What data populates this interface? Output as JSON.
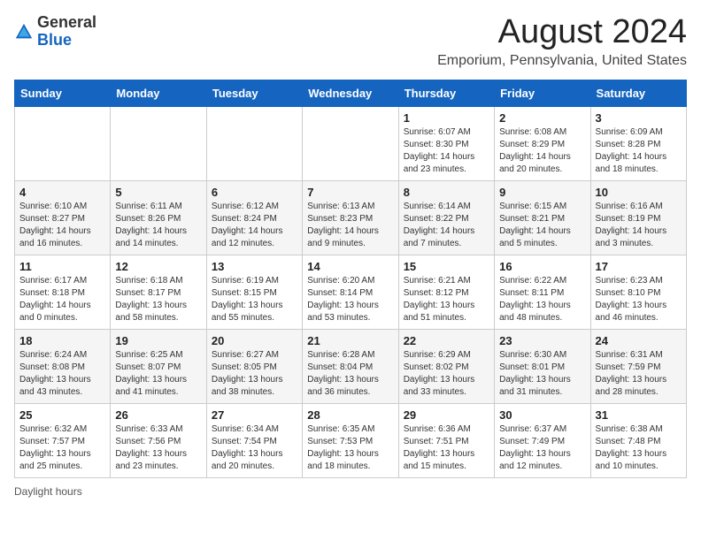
{
  "header": {
    "logo_general": "General",
    "logo_blue": "Blue",
    "title": "August 2024",
    "subtitle": "Emporium, Pennsylvania, United States"
  },
  "calendar": {
    "days_of_week": [
      "Sunday",
      "Monday",
      "Tuesday",
      "Wednesday",
      "Thursday",
      "Friday",
      "Saturday"
    ],
    "weeks": [
      [
        {
          "num": "",
          "info": ""
        },
        {
          "num": "",
          "info": ""
        },
        {
          "num": "",
          "info": ""
        },
        {
          "num": "",
          "info": ""
        },
        {
          "num": "1",
          "info": "Sunrise: 6:07 AM\nSunset: 8:30 PM\nDaylight: 14 hours and 23 minutes."
        },
        {
          "num": "2",
          "info": "Sunrise: 6:08 AM\nSunset: 8:29 PM\nDaylight: 14 hours and 20 minutes."
        },
        {
          "num": "3",
          "info": "Sunrise: 6:09 AM\nSunset: 8:28 PM\nDaylight: 14 hours and 18 minutes."
        }
      ],
      [
        {
          "num": "4",
          "info": "Sunrise: 6:10 AM\nSunset: 8:27 PM\nDaylight: 14 hours and 16 minutes."
        },
        {
          "num": "5",
          "info": "Sunrise: 6:11 AM\nSunset: 8:26 PM\nDaylight: 14 hours and 14 minutes."
        },
        {
          "num": "6",
          "info": "Sunrise: 6:12 AM\nSunset: 8:24 PM\nDaylight: 14 hours and 12 minutes."
        },
        {
          "num": "7",
          "info": "Sunrise: 6:13 AM\nSunset: 8:23 PM\nDaylight: 14 hours and 9 minutes."
        },
        {
          "num": "8",
          "info": "Sunrise: 6:14 AM\nSunset: 8:22 PM\nDaylight: 14 hours and 7 minutes."
        },
        {
          "num": "9",
          "info": "Sunrise: 6:15 AM\nSunset: 8:21 PM\nDaylight: 14 hours and 5 minutes."
        },
        {
          "num": "10",
          "info": "Sunrise: 6:16 AM\nSunset: 8:19 PM\nDaylight: 14 hours and 3 minutes."
        }
      ],
      [
        {
          "num": "11",
          "info": "Sunrise: 6:17 AM\nSunset: 8:18 PM\nDaylight: 14 hours and 0 minutes."
        },
        {
          "num": "12",
          "info": "Sunrise: 6:18 AM\nSunset: 8:17 PM\nDaylight: 13 hours and 58 minutes."
        },
        {
          "num": "13",
          "info": "Sunrise: 6:19 AM\nSunset: 8:15 PM\nDaylight: 13 hours and 55 minutes."
        },
        {
          "num": "14",
          "info": "Sunrise: 6:20 AM\nSunset: 8:14 PM\nDaylight: 13 hours and 53 minutes."
        },
        {
          "num": "15",
          "info": "Sunrise: 6:21 AM\nSunset: 8:12 PM\nDaylight: 13 hours and 51 minutes."
        },
        {
          "num": "16",
          "info": "Sunrise: 6:22 AM\nSunset: 8:11 PM\nDaylight: 13 hours and 48 minutes."
        },
        {
          "num": "17",
          "info": "Sunrise: 6:23 AM\nSunset: 8:10 PM\nDaylight: 13 hours and 46 minutes."
        }
      ],
      [
        {
          "num": "18",
          "info": "Sunrise: 6:24 AM\nSunset: 8:08 PM\nDaylight: 13 hours and 43 minutes."
        },
        {
          "num": "19",
          "info": "Sunrise: 6:25 AM\nSunset: 8:07 PM\nDaylight: 13 hours and 41 minutes."
        },
        {
          "num": "20",
          "info": "Sunrise: 6:27 AM\nSunset: 8:05 PM\nDaylight: 13 hours and 38 minutes."
        },
        {
          "num": "21",
          "info": "Sunrise: 6:28 AM\nSunset: 8:04 PM\nDaylight: 13 hours and 36 minutes."
        },
        {
          "num": "22",
          "info": "Sunrise: 6:29 AM\nSunset: 8:02 PM\nDaylight: 13 hours and 33 minutes."
        },
        {
          "num": "23",
          "info": "Sunrise: 6:30 AM\nSunset: 8:01 PM\nDaylight: 13 hours and 31 minutes."
        },
        {
          "num": "24",
          "info": "Sunrise: 6:31 AM\nSunset: 7:59 PM\nDaylight: 13 hours and 28 minutes."
        }
      ],
      [
        {
          "num": "25",
          "info": "Sunrise: 6:32 AM\nSunset: 7:57 PM\nDaylight: 13 hours and 25 minutes."
        },
        {
          "num": "26",
          "info": "Sunrise: 6:33 AM\nSunset: 7:56 PM\nDaylight: 13 hours and 23 minutes."
        },
        {
          "num": "27",
          "info": "Sunrise: 6:34 AM\nSunset: 7:54 PM\nDaylight: 13 hours and 20 minutes."
        },
        {
          "num": "28",
          "info": "Sunrise: 6:35 AM\nSunset: 7:53 PM\nDaylight: 13 hours and 18 minutes."
        },
        {
          "num": "29",
          "info": "Sunrise: 6:36 AM\nSunset: 7:51 PM\nDaylight: 13 hours and 15 minutes."
        },
        {
          "num": "30",
          "info": "Sunrise: 6:37 AM\nSunset: 7:49 PM\nDaylight: 13 hours and 12 minutes."
        },
        {
          "num": "31",
          "info": "Sunrise: 6:38 AM\nSunset: 7:48 PM\nDaylight: 13 hours and 10 minutes."
        }
      ]
    ]
  },
  "footer": {
    "note": "Daylight hours"
  }
}
